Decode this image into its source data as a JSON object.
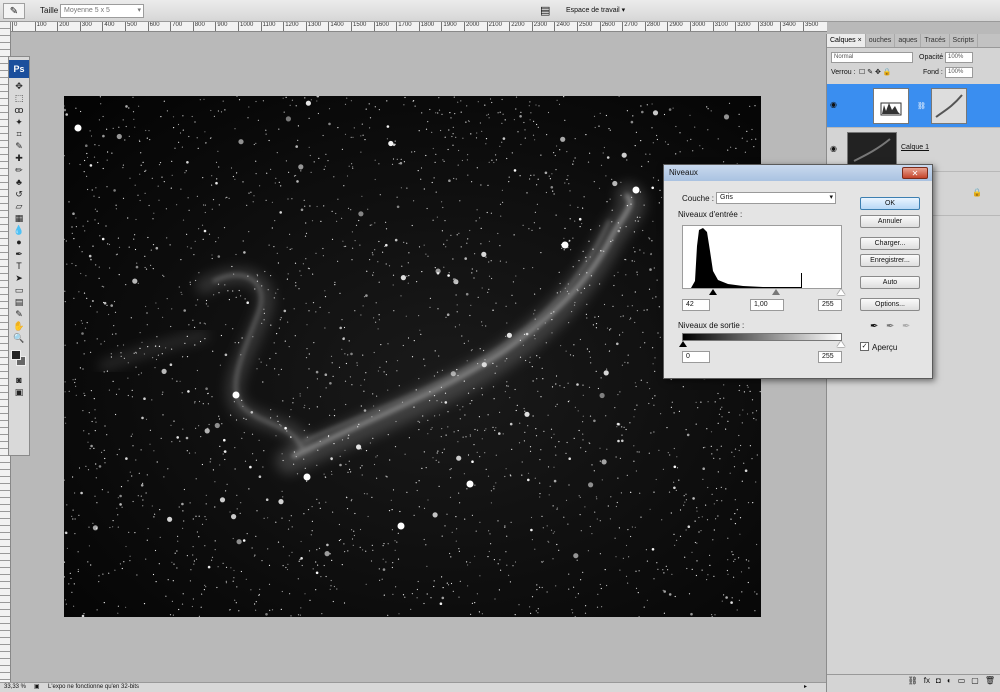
{
  "options_bar": {
    "size_label": "Taille :",
    "size_value": "Moyenne 5 x 5",
    "workspace_label": "Espace de travail"
  },
  "ruler": {
    "ticks": [
      "0",
      "100",
      "200",
      "300",
      "400",
      "500",
      "600",
      "700",
      "800",
      "900",
      "1000",
      "1100",
      "1200",
      "1300",
      "1400",
      "1500",
      "1600",
      "1700",
      "1800",
      "1900",
      "2000",
      "2100",
      "2200",
      "2300",
      "2400",
      "2500",
      "2600",
      "2700",
      "2800",
      "2900",
      "3000",
      "3100",
      "3200",
      "3300",
      "3400",
      "3500"
    ]
  },
  "toolbox": {
    "logo": "Ps"
  },
  "layers_panel": {
    "tabs": [
      "Calques",
      "ouches",
      "aques",
      "Tracés",
      "Scripts"
    ],
    "blend_mode": "Normal",
    "opacity_label": "Opacité :",
    "opacity_value": "100%",
    "lock_label": "Verrou :",
    "fill_label": "Fond :",
    "fill_value": "100%",
    "layers": [
      {
        "name": "",
        "active": true,
        "type": "levels-adjustment"
      },
      {
        "name": "Calque 1",
        "active": false,
        "type": "image"
      }
    ]
  },
  "levels_dialog": {
    "title": "Niveaux",
    "channel_label": "Couche :",
    "channel_value": "Gris",
    "input_label": "Niveaux d'entrée :",
    "input_black": "42",
    "input_gamma": "1,00",
    "input_white": "255",
    "output_label": "Niveaux de sortie :",
    "output_black": "0",
    "output_white": "255",
    "buttons": {
      "ok": "OK",
      "cancel": "Annuler",
      "load": "Charger...",
      "save": "Enregistrer...",
      "auto": "Auto",
      "options": "Options..."
    },
    "preview_label": "Aperçu",
    "preview_checked": true
  },
  "status_bar": {
    "zoom": "33,33 %",
    "message": "L'expo ne fonctionne qu'en 32-bits"
  }
}
